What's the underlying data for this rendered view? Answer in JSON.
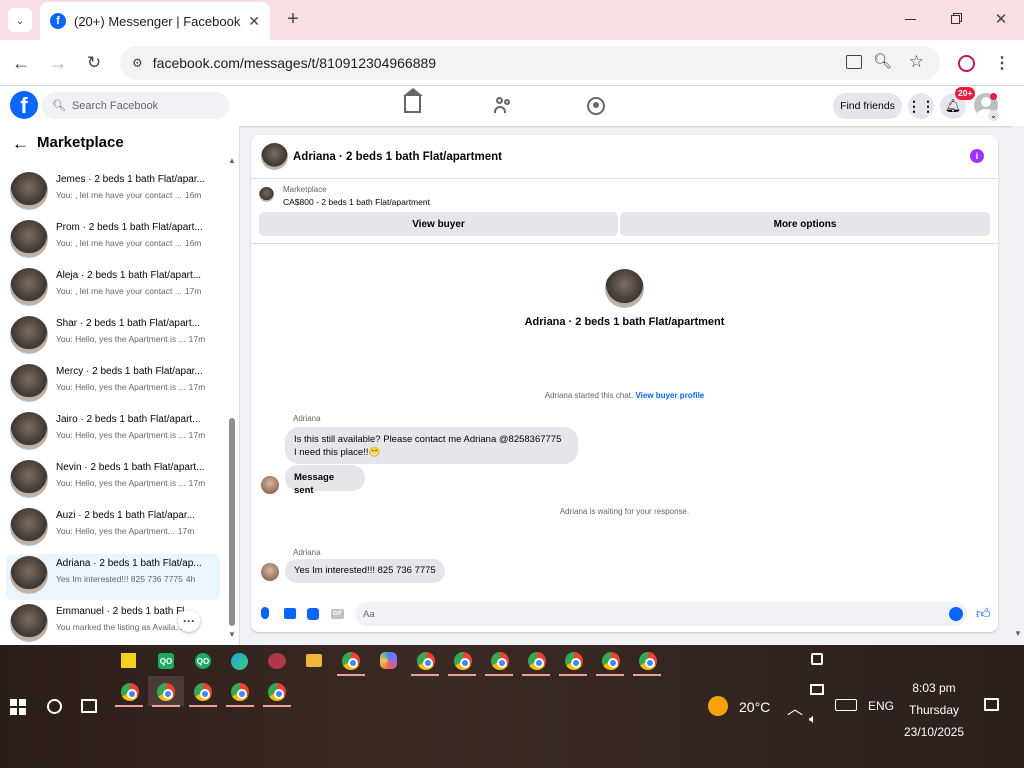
{
  "browser": {
    "tab_title": "(20+) Messenger | Facebook",
    "url": "facebook.com/messages/t/810912304966889"
  },
  "fbnav": {
    "search_placeholder": "Search Facebook",
    "find_friends": "Find friends",
    "notif_badge": "20+"
  },
  "sidebar": {
    "title": "Marketplace",
    "conversations": [
      {
        "name": "Jemes · 2 beds 1 bath Flat/apar...",
        "preview": "You: , let me have your contact ...",
        "time": "16m"
      },
      {
        "name": "Prom · 2 beds 1 bath Flat/apart...",
        "preview": "You: , let me have your contact ...",
        "time": "16m"
      },
      {
        "name": "Aleja · 2 beds 1 bath Flat/apart...",
        "preview": "You: , let me have your contact ...",
        "time": "17m"
      },
      {
        "name": "Shar · 2 beds 1 bath Flat/apart...",
        "preview": "You: Hello, yes the Apartment is ...",
        "time": "17m"
      },
      {
        "name": "Mercy · 2 beds 1 bath Flat/apar...",
        "preview": "You: Hello, yes the Apartment is ...",
        "time": "17m"
      },
      {
        "name": "Jairo · 2 beds 1 bath Flat/apart...",
        "preview": "You: Hello, yes the Apartment is ...",
        "time": "17m"
      },
      {
        "name": "Nevin · 2 beds 1 bath Flat/apart...",
        "preview": "You: Hello, yes the Apartment is ...",
        "time": "17m"
      },
      {
        "name": "Auzi · 2 beds 1 bath Flat/apar...",
        "preview": "You: Hello, yes the Apartment...",
        "time": "17m"
      },
      {
        "name": "Adriana · 2 beds 1 bath Flat/ap...",
        "preview": "Yes Im interested!!! 825 736 7775",
        "time": "4h"
      },
      {
        "name": "Emmanuel · 2 beds 1 bath Fl...",
        "preview": "You marked the listing as Availa...",
        "time": "h"
      }
    ]
  },
  "chat": {
    "header_title": "Adriana · 2 beds 1 bath Flat/apartment",
    "listing_source": "Marketplace",
    "listing_price": "CA$800 - 2 beds 1 bath Flat/apartment",
    "view_buyer": "View buyer",
    "more_options": "More options",
    "profile_name": "Adriana · 2 beds 1 bath Flat/apartment",
    "started_text": "Adriana started this chat.",
    "view_buyer_profile": "View buyer profile",
    "sender1": "Adriana",
    "msg1_line1": "Is this still available? Please contact me Adriana @8258367775",
    "msg1_line2": "I need this place!!😁",
    "msg2": "Message sent",
    "waiting": "Adriana is waiting for your response.",
    "sender2": "Adriana",
    "msg3": "Yes Im interested!!! 825 736 7775",
    "composer_placeholder": "Aa"
  },
  "taskbar": {
    "weather": "20°C",
    "lang": "ENG",
    "time": "8:03 pm",
    "day": "Thursday",
    "date": "23/10/2025"
  },
  "colors": {
    "fb_blue": "#0866ff",
    "accent_purple": "#a033ff",
    "badge_red": "#e41e3f"
  }
}
